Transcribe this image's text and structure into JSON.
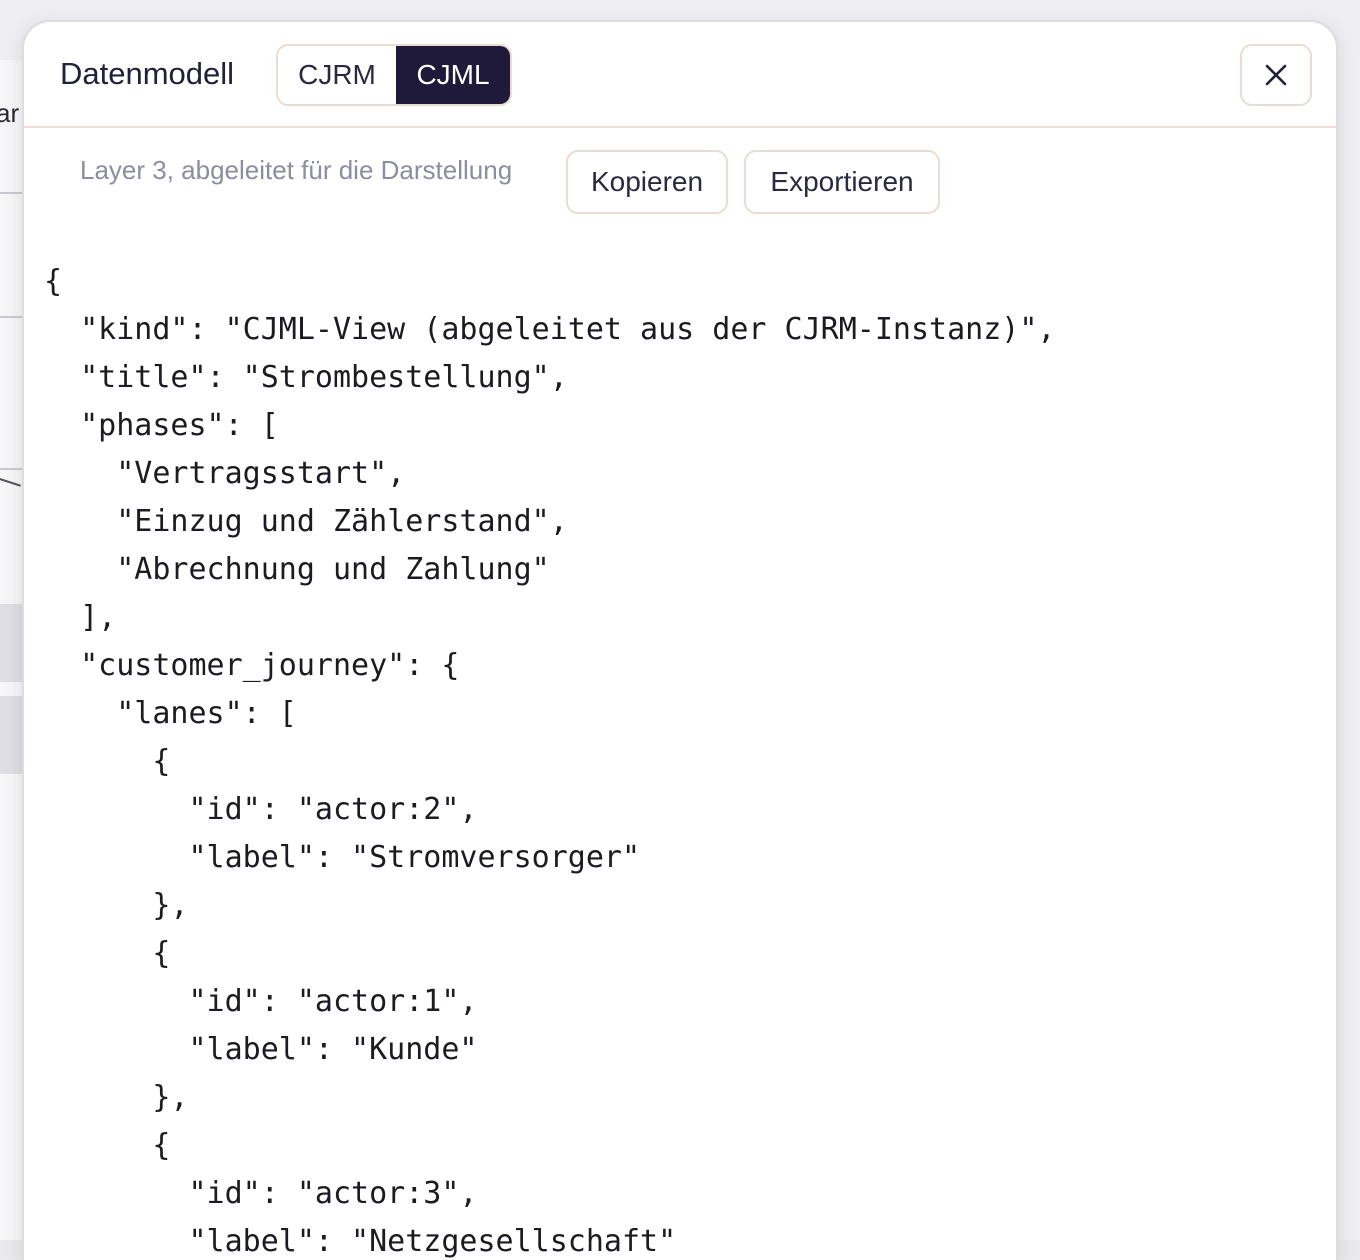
{
  "backdrop": {
    "partial_text": "ar"
  },
  "modal": {
    "title": "Datenmodell",
    "tabs": [
      {
        "label": "CJRM",
        "active": false
      },
      {
        "label": "CJML",
        "active": true
      }
    ],
    "close_icon": "close-icon",
    "caption": "Layer 3, abgeleitet für die Darstellung",
    "buttons": {
      "copy": "Kopieren",
      "export": "Exportieren"
    },
    "code_lines": [
      "{",
      "  \"kind\": \"CJML-View (abgeleitet aus der CJRM-Instanz)\",",
      "  \"title\": \"Strombestellung\",",
      "  \"phases\": [",
      "    \"Vertragsstart\",",
      "    \"Einzug und Zählerstand\",",
      "    \"Abrechnung und Zahlung\"",
      "  ],",
      "  \"customer_journey\": {",
      "    \"lanes\": [",
      "      {",
      "        \"id\": \"actor:2\",",
      "        \"label\": \"Stromversorger\"",
      "      },",
      "      {",
      "        \"id\": \"actor:1\",",
      "        \"label\": \"Kunde\"",
      "      },",
      "      {",
      "        \"id\": \"actor:3\",",
      "        \"label\": \"Netzgesellschaft\""
    ]
  },
  "colors": {
    "active_tab_bg": "#1f1a3a",
    "border": "#e8ddd2",
    "caption": "#8d8da0"
  }
}
